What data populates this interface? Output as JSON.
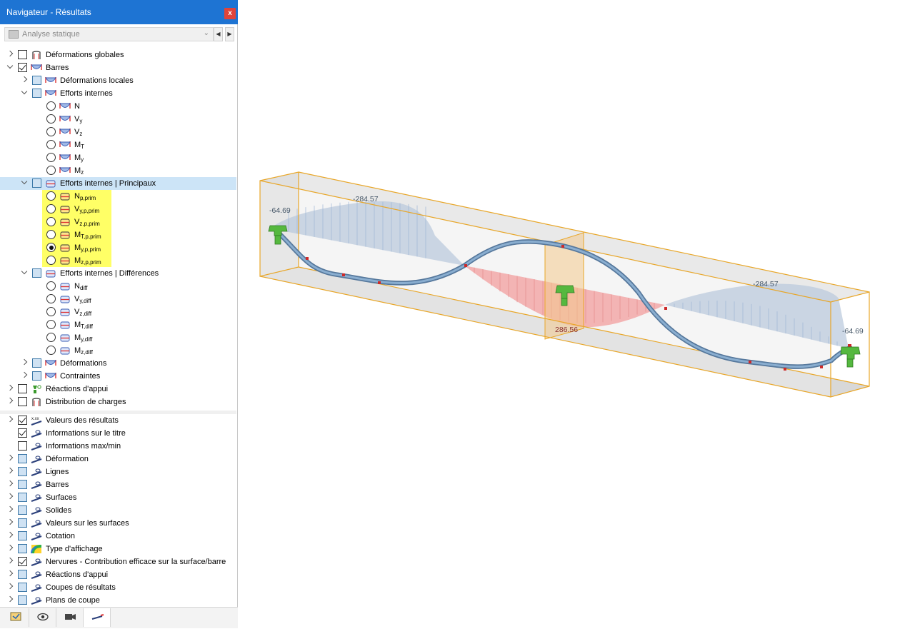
{
  "window": {
    "title": "Navigateur - Résultats",
    "close": "x"
  },
  "combo": {
    "value": "Analyse statique"
  },
  "tree": [
    {
      "label": "Déformations globales"
    },
    {
      "label": "Barres"
    },
    {
      "label": "Déformations locales"
    },
    {
      "label": "Efforts internes"
    },
    {
      "label": "N"
    },
    {
      "label": "V",
      "sub": "y"
    },
    {
      "label": "V",
      "sub": "z"
    },
    {
      "label": "M",
      "sub": "T"
    },
    {
      "label": "M",
      "sub": "y"
    },
    {
      "label": "M",
      "sub": "z"
    },
    {
      "label": "Efforts internes | Principaux"
    },
    {
      "label": "N",
      "sub": "p,prim"
    },
    {
      "label": "V",
      "sub": "y,p,prim"
    },
    {
      "label": "V",
      "sub": "z,p,prim"
    },
    {
      "label": "M",
      "sub": "T,p,prim"
    },
    {
      "label": "M",
      "sub": "y,p,prim"
    },
    {
      "label": "M",
      "sub": "z,p,prim"
    },
    {
      "label": "Efforts internes | Différences"
    },
    {
      "label": "N",
      "sub": "diff"
    },
    {
      "label": "V",
      "sub": "y,diff"
    },
    {
      "label": "V",
      "sub": "z,diff"
    },
    {
      "label": "M",
      "sub": "T,diff"
    },
    {
      "label": "M",
      "sub": "y,diff"
    },
    {
      "label": "M",
      "sub": "z,diff"
    },
    {
      "label": "Déformations"
    },
    {
      "label": "Contraintes"
    },
    {
      "label": "Réactions d'appui"
    },
    {
      "label": "Distribution de charges"
    }
  ],
  "display_tree": [
    {
      "label": "Valeurs des résultats"
    },
    {
      "label": "Informations sur le titre"
    },
    {
      "label": "Informations max/min"
    },
    {
      "label": "Déformation"
    },
    {
      "label": "Lignes"
    },
    {
      "label": "Barres"
    },
    {
      "label": "Surfaces"
    },
    {
      "label": "Solides"
    },
    {
      "label": "Valeurs sur les surfaces"
    },
    {
      "label": "Cotation"
    },
    {
      "label": "Type d'affichage"
    },
    {
      "label": "Nervures - Contribution efficace sur la surface/barre"
    },
    {
      "label": "Réactions d'appui"
    },
    {
      "label": "Coupes de résultats"
    },
    {
      "label": "Plans de coupe"
    }
  ],
  "values_icon_text": "x.xx",
  "viewport": {
    "labels": [
      "-64.69",
      "-284.57",
      "286.56",
      "-284.57",
      "-64.69"
    ]
  },
  "colors": {
    "titlebar": "#1e74d3",
    "highlight": "#ffff66",
    "selection": "#cce4f7",
    "box_edge": "#e8a628",
    "beam": "#6f91b3",
    "negative_fill": "#b8c8dc",
    "positive_fill": "#f2a4a4",
    "support": "#55b83f"
  }
}
